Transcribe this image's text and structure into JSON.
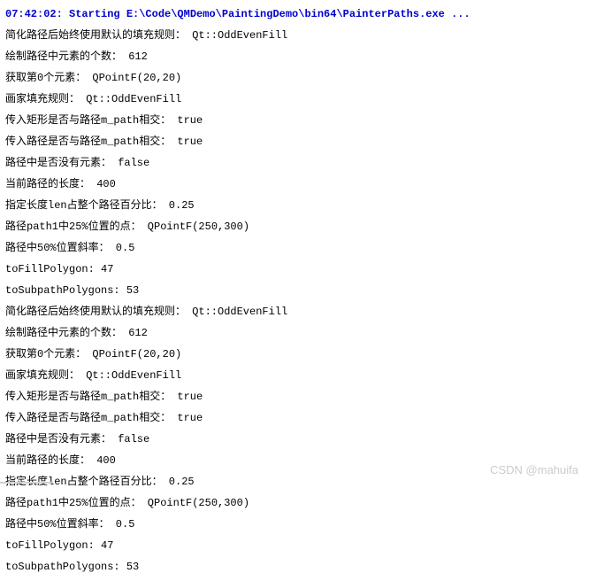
{
  "header": "07:42:02: Starting E:\\Code\\QMDemo\\PaintingDemo\\bin64\\PainterPaths.exe ...",
  "lines": [
    "简化路径后始终使用默认的填充规则：  Qt::OddEvenFill",
    "绘制路径中元素的个数：  612",
    "获取第0个元素：  QPointF(20,20)",
    "画家填充规则：  Qt::OddEvenFill",
    "传入矩形是否与路径m_path相交：  true",
    "传入路径是否与路径m_path相交：  true",
    "路径中是否没有元素：  false",
    "当前路径的长度：  400",
    "指定长度len占整个路径百分比：  0.25",
    "路径path1中25%位置的点：  QPointF(250,300)",
    "路径中50%位置斜率：  0.5",
    "toFillPolygon:  47",
    "toSubpathPolygons:  53",
    "简化路径后始终使用默认的填充规则：  Qt::OddEvenFill",
    "绘制路径中元素的个数：  612",
    "获取第0个元素：  QPointF(20,20)",
    "画家填充规则：  Qt::OddEvenFill",
    "传入矩形是否与路径m_path相交：  true",
    "传入路径是否与路径m_path相交：  true",
    "路径中是否没有元素：  false",
    "当前路径的长度：  400",
    "指定长度len占整个路径百分比：  0.25",
    "路径path1中25%位置的点：  QPointF(250,300)",
    "路径中50%位置斜率：  0.5",
    "toFillPolygon:  47",
    "toSubpathPolygons:  53"
  ],
  "watermark": "CSDN @mahuifa"
}
